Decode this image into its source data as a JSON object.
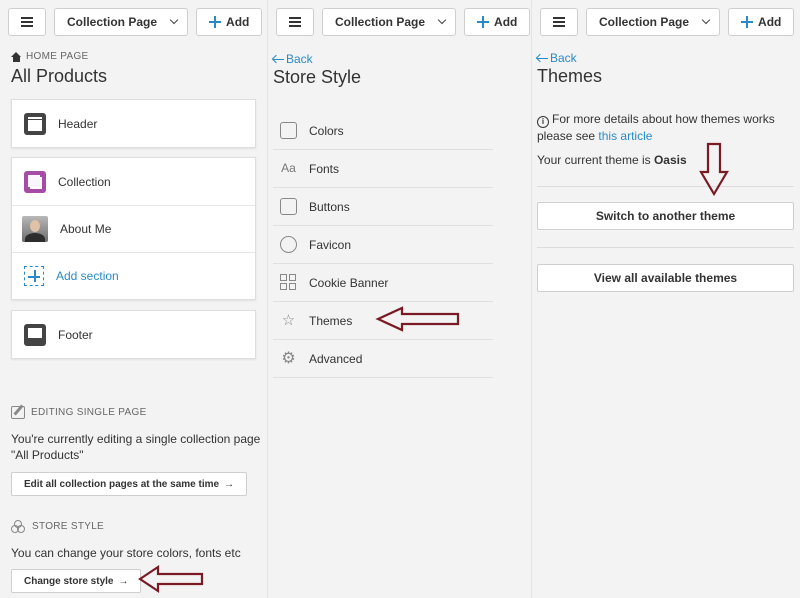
{
  "toolbar": {
    "page_select_label": "Collection Page",
    "add_label": "Add"
  },
  "panel1": {
    "breadcrumb": "HOME PAGE",
    "title": "All Products",
    "sections": {
      "header": "Header",
      "collection": "Collection",
      "about": "About Me",
      "add_section": "Add section",
      "footer": "Footer"
    },
    "editing_heading": "EDITING SINGLE PAGE",
    "editing_text_1": "You're currently editing a single collection page",
    "editing_text_2": "\"All Products\"",
    "edit_all_button": "Edit all collection pages at the same time",
    "store_style_heading": "STORE STYLE",
    "store_style_text": "You can change your store colors, fonts etc",
    "change_style_button": "Change store style"
  },
  "panel2": {
    "back": "Back",
    "title": "Store Style",
    "menu": {
      "colors": "Colors",
      "fonts": "Fonts",
      "buttons": "Buttons",
      "favicon": "Favicon",
      "cookie": "Cookie Banner",
      "themes": "Themes",
      "advanced": "Advanced"
    }
  },
  "panel3": {
    "back": "Back",
    "title": "Themes",
    "info_text": "For more details about how themes works please see ",
    "info_link": "this article",
    "current_prefix": "Your current theme is ",
    "current_theme": "Oasis",
    "switch_button": "Switch to another theme",
    "view_all_button": "View all available themes"
  },
  "icons": {
    "menu": "hamburger-icon",
    "add": "plus-icon",
    "home": "home-icon",
    "info": "info-icon"
  },
  "colors": {
    "accent": "#2a8ac6",
    "annotation_arrow": "#7a1a24",
    "collection_icon": "#a64ca6"
  }
}
